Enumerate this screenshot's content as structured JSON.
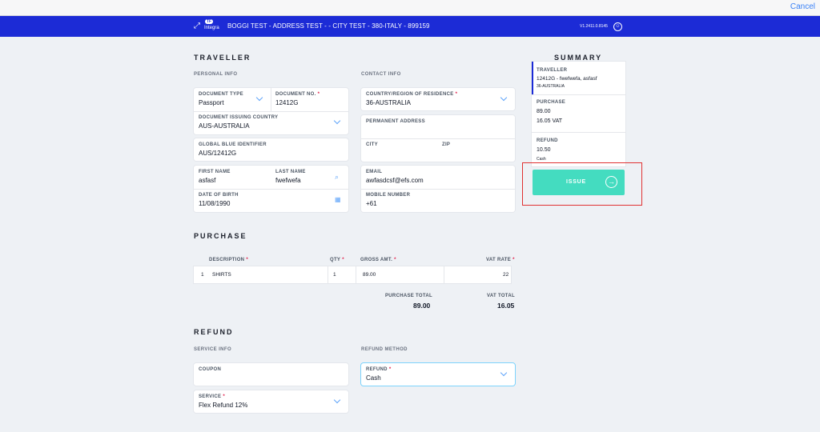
{
  "topbar": {
    "cancel_label": "Cancel"
  },
  "header": {
    "logo_badge": "TF",
    "logo_text": "Integra",
    "title": "BOGGI TEST - ADDRESS TEST - - CITY TEST - 380-ITALY - 899159",
    "version": "V1.2411.0.8145"
  },
  "traveller": {
    "title": "TRAVELLER",
    "personal_info": "PERSONAL INFO",
    "contact_info": "CONTACT INFO",
    "document_type_label": "DOCUMENT TYPE",
    "document_type_value": "Passport",
    "document_no_label": "DOCUMENT NO.",
    "document_no_value": "12412G",
    "issuing_country_label": "DOCUMENT ISSUING COUNTRY",
    "issuing_country_value": "AUS-AUSTRALIA",
    "gb_id_label": "GLOBAL BLUE IDENTIFIER",
    "gb_id_value": "AUS/12412G",
    "first_name_label": "FIRST NAME",
    "first_name_value": "asfasf",
    "last_name_label": "LAST NAME",
    "last_name_value": "fwefwefa",
    "dob_label": "DATE OF BIRTH",
    "dob_value": "11/08/1990",
    "country_residence_label": "COUNTRY/REGION OF RESIDENCE",
    "country_residence_value": "36-AUSTRALIA",
    "permanent_address_label": "PERMANENT ADDRESS",
    "permanent_address_value": "",
    "city_label": "CITY",
    "city_value": "",
    "zip_label": "ZIP",
    "zip_value": "",
    "email_label": "EMAIL",
    "email_value": "awfasdcsf@efs.com",
    "mobile_label": "MOBILE NUMBER",
    "mobile_value": "+61"
  },
  "purchase": {
    "title": "PURCHASE",
    "columns": {
      "description": "DESCRIPTION",
      "qty": "QTY",
      "gross": "GROSS AMT.",
      "vat": "VAT RATE"
    },
    "rows": [
      {
        "index": "1",
        "description": "SHIRTS",
        "qty": "1",
        "gross": "89.00",
        "vat": "22"
      }
    ],
    "purchase_total_label": "PURCHASE TOTAL",
    "purchase_total_value": "89.00",
    "vat_total_label": "VAT TOTAL",
    "vat_total_value": "16.05"
  },
  "refund": {
    "title": "REFUND",
    "service_info": "SERVICE INFO",
    "refund_method": "REFUND METHOD",
    "coupon_label": "COUPON",
    "coupon_value": "",
    "refund_label": "REFUND",
    "refund_value": "Cash",
    "service_label": "SERVICE",
    "service_value": "Flex Refund 12%"
  },
  "summary": {
    "title": "SUMMARY",
    "traveller_label": "TRAVELLER",
    "traveller_value": "12412G  -  fwefwefa, asfasf",
    "traveller_country": "36-AUSTRALIA",
    "purchase_label": "PURCHASE",
    "purchase_value": "89.00",
    "vat_value": "16.05 VAT",
    "refund_label": "REFUND",
    "refund_value": "10.50",
    "refund_method": "Cash",
    "issue_label": "ISSUE"
  },
  "colors": {
    "header": "#1c2bd6",
    "issue_button": "#44dcc0",
    "highlight": "#e03131",
    "required": "#e11d48"
  },
  "icons": [
    "user-icon",
    "search-icon",
    "calendar-icon",
    "chevron-down-icon",
    "arrow-right-circle-icon"
  ]
}
